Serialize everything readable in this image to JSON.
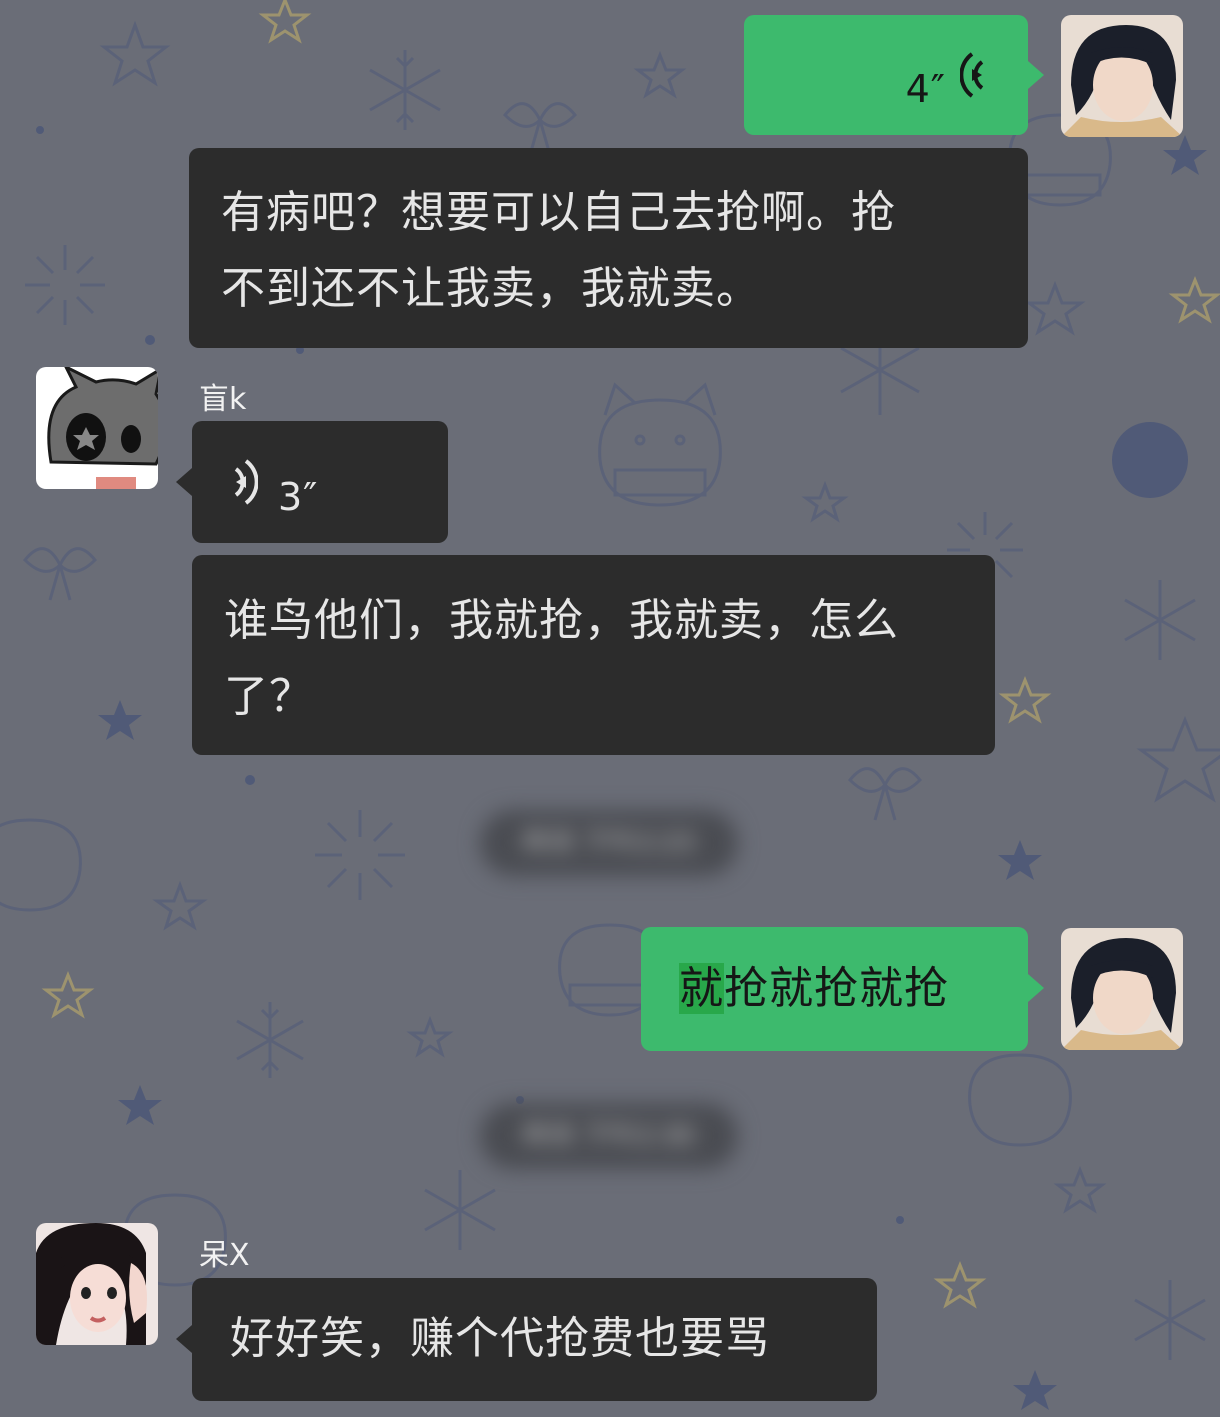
{
  "messages": [
    {
      "id": "m1",
      "side": "right",
      "type": "voice",
      "duration": "4″"
    },
    {
      "id": "m2",
      "side": "right",
      "type": "text",
      "lines": [
        "有病吧？想要可以自己去抢啊。抢",
        "不到还不让我卖，我就卖。"
      ]
    },
    {
      "id": "m3",
      "side": "left",
      "sender": "盲k",
      "type": "voice",
      "duration": "3″"
    },
    {
      "id": "m4",
      "side": "left",
      "type": "text",
      "lines": [
        "谁鸟他们，我就抢，我就卖，怎么",
        "了？"
      ]
    },
    {
      "id": "t1",
      "type": "timestamp",
      "text": "昨天 下午2:23"
    },
    {
      "id": "m5",
      "side": "right",
      "type": "text",
      "highlight": "就",
      "rest": "抢就抢就抢"
    },
    {
      "id": "t2",
      "type": "timestamp",
      "text": "昨天 下午2:30"
    },
    {
      "id": "m6",
      "side": "left",
      "sender": "呆X",
      "type": "text",
      "lines": [
        "好好笑，赚个代抢费也要骂"
      ]
    }
  ],
  "colors": {
    "background": "#6a6d77",
    "bubble_dark": "#2c2c2c",
    "bubble_green": "#3dba6d",
    "highlight": "#28a84a"
  },
  "icons": [
    "voice-wave-icon"
  ]
}
